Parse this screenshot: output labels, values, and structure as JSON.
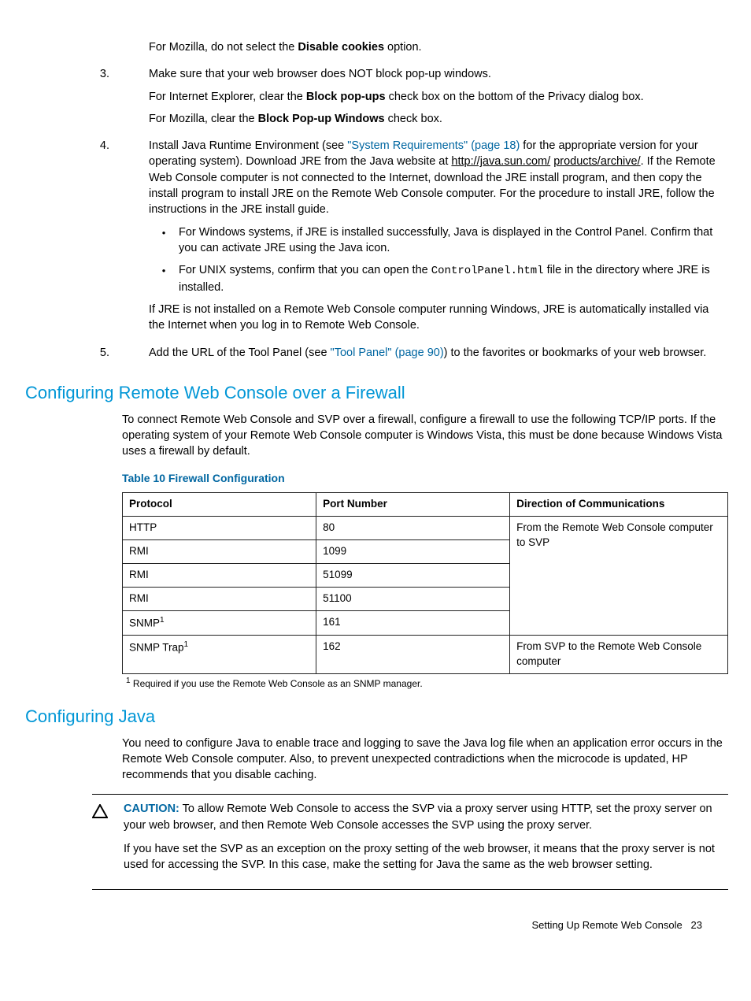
{
  "steps": {
    "s2_mozilla": "For Mozilla, do not select the ",
    "s2_bold": "Disable cookies",
    "s2_after": " option.",
    "s3_num": "3.",
    "s3_p1": "Make sure that your web browser does NOT block pop-up windows.",
    "s3_p2a": "For Internet Explorer, clear the ",
    "s3_p2b": "Block pop-ups",
    "s3_p2c": " check box on the bottom of the Privacy dialog box.",
    "s3_p3a": "For Mozilla, clear the ",
    "s3_p3b": "Block Pop-up Windows",
    "s3_p3c": " check box.",
    "s4_num": "4.",
    "s4_p1a": "Install Java Runtime Environment (see ",
    "s4_link1": "\"System Requirements\" (page 18)",
    "s4_p1b": " for the appropriate version for your operating system). Download JRE from the Java website at ",
    "s4_link2a": "http://java.sun.com/",
    "s4_link2b": "products/archive/",
    "s4_p1c": ". If the Remote Web Console computer is not connected to the Internet, download the JRE install program, and then copy the install program to install JRE on the Remote Web Console computer. For the procedure to install JRE, follow the instructions in the JRE install guide.",
    "s4_b1": "For Windows systems, if JRE is installed successfully, Java is displayed in the Control Panel. Confirm that you can activate JRE using the Java icon.",
    "s4_b2a": "For UNIX systems, confirm that you can open the ",
    "s4_b2code": "ControlPanel.html",
    "s4_b2b": " file in the directory where JRE is installed.",
    "s4_p2": "If JRE is not installed on a Remote Web Console computer running Windows, JRE is automatically installed via the Internet when you log in to Remote Web Console.",
    "s5_num": "5.",
    "s5_p1a": "Add the URL of the Tool Panel (see ",
    "s5_link": "\"Tool Panel\" (page 90)",
    "s5_p1b": ") to the favorites or bookmarks of your web browser."
  },
  "firewall": {
    "heading": "Configuring Remote Web Console over a Firewall",
    "intro": "To connect Remote Web Console and SVP over a firewall, configure a firewall to use the following TCP/IP ports. If the operating system of your Remote Web Console computer is Windows Vista, this must be done because Windows Vista uses a firewall by default.",
    "table_caption": "Table 10 Firewall Configuration",
    "th1": "Protocol",
    "th2": "Port Number",
    "th3": "Direction of Communications",
    "rows": [
      {
        "proto": "HTTP",
        "port": "80"
      },
      {
        "proto": "RMI",
        "port": "1099"
      },
      {
        "proto": "RMI",
        "port": "51099"
      },
      {
        "proto": "RMI",
        "port": "51100"
      },
      {
        "proto_pre": "SNMP",
        "proto_sup": "1",
        "port": "161"
      },
      {
        "proto_pre": "SNMP Trap",
        "proto_sup": "1",
        "port": "162"
      }
    ],
    "dir1": "From the Remote Web Console computer to SVP",
    "dir2": "From SVP to the Remote Web Console computer",
    "footnote_sup": "1",
    "footnote_txt": "  Required if you use the Remote Web Console as an SNMP manager."
  },
  "java": {
    "heading": "Configuring Java",
    "intro": "You need to configure Java to enable trace and logging to save the Java log file when an application error occurs in the Remote Web Console computer. Also, to prevent unexpected contradictions when the microcode is updated, HP recommends that you disable caching.",
    "caution_label": "CAUTION:",
    "caution_p1": "   To allow Remote Web Console to access the SVP via a proxy server using HTTP, set the proxy server on your web browser, and then Remote Web Console accesses the SVP using the proxy server.",
    "caution_p2": "If you have set the SVP as an exception on the proxy setting of the web browser, it means that the proxy server is not used for accessing the SVP. In this case, make the setting for Java the same as the web browser setting."
  },
  "footer": {
    "text": "Setting Up Remote Web Console",
    "page": "23"
  }
}
